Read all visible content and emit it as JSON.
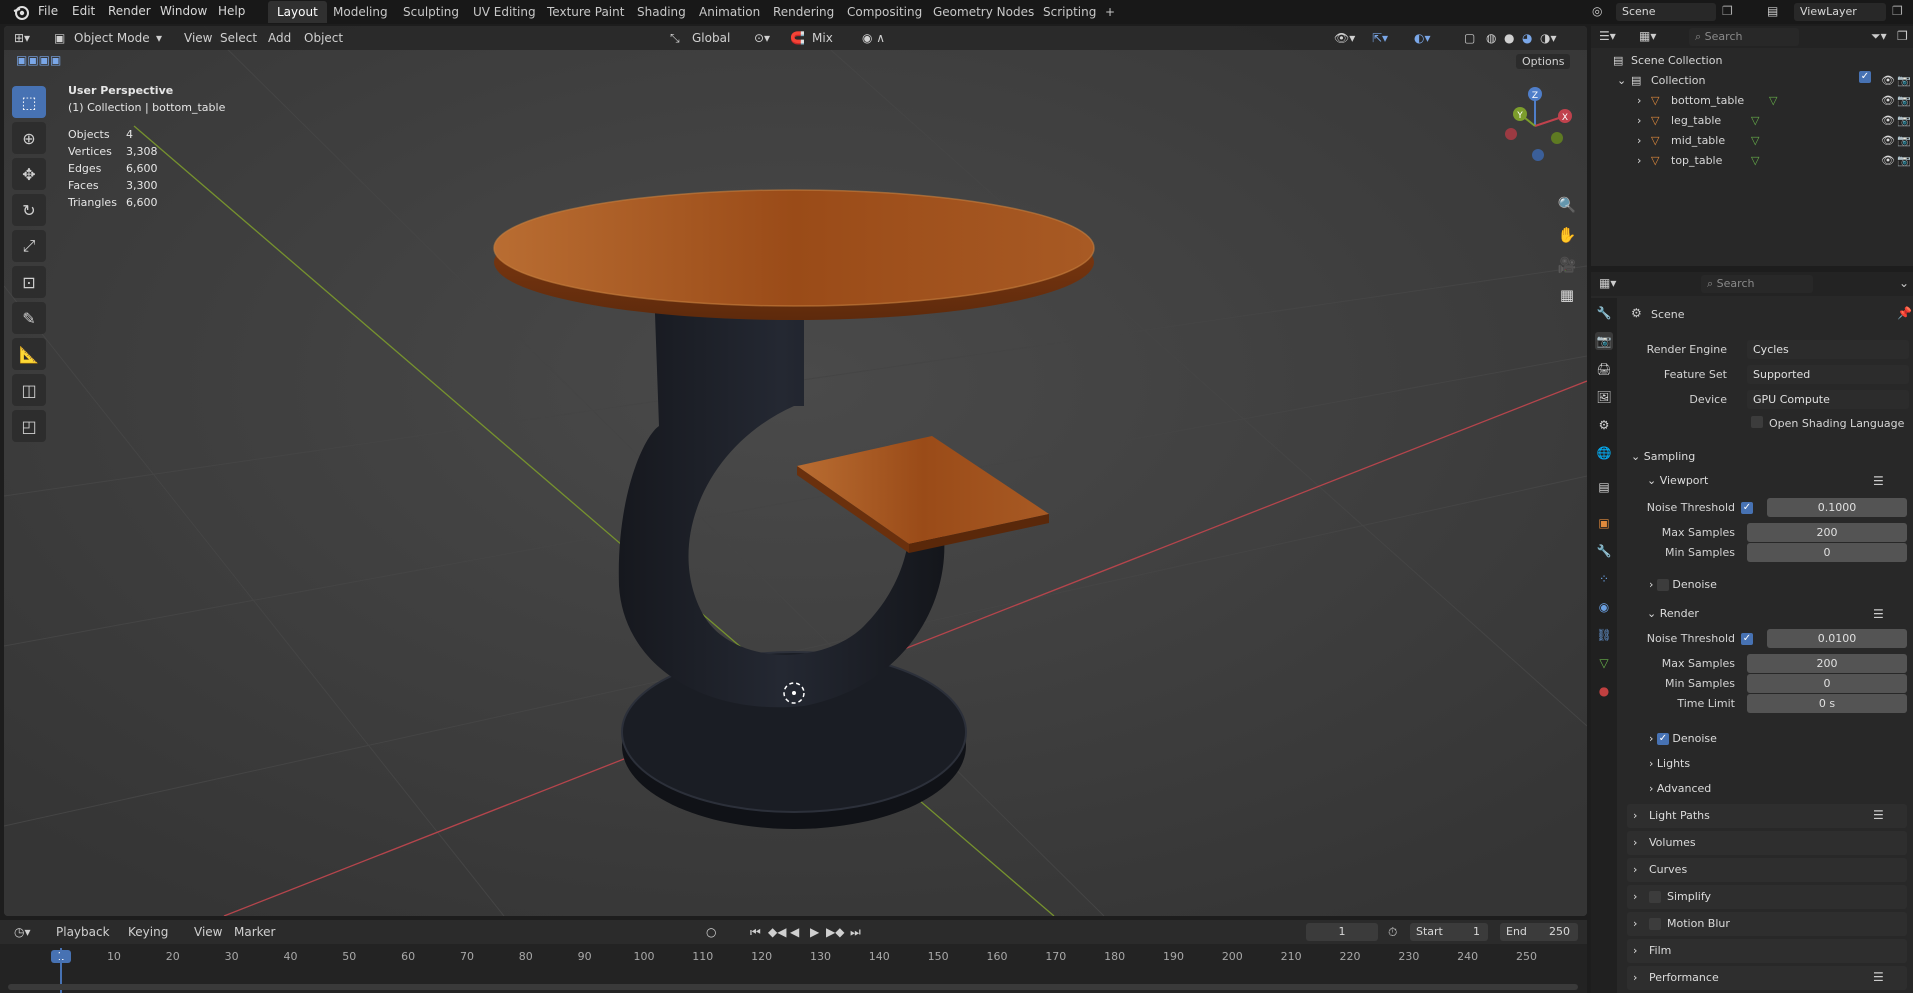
{
  "menu": [
    "File",
    "Edit",
    "Render",
    "Window",
    "Help"
  ],
  "workspaces": [
    "Layout",
    "Modeling",
    "Sculpting",
    "UV Editing",
    "Texture Paint",
    "Shading",
    "Animation",
    "Rendering",
    "Compositing",
    "Geometry Nodes",
    "Scripting"
  ],
  "add_workspace": "+",
  "scene_name": "Scene",
  "view_layer": "ViewLayer",
  "viewport": {
    "mode": "Object Mode",
    "menus": [
      "View",
      "Select",
      "Add",
      "Object"
    ],
    "transform_orientation": "Global",
    "snap_mode": "Mix",
    "options_label": "Options",
    "perspective": "User Perspective",
    "active_info": "(1) Collection | bottom_table",
    "stats": [
      {
        "label": "Objects",
        "value": "4"
      },
      {
        "label": "Vertices",
        "value": "3,308"
      },
      {
        "label": "Edges",
        "value": "6,600"
      },
      {
        "label": "Faces",
        "value": "3,300"
      },
      {
        "label": "Triangles",
        "value": "6,600"
      }
    ],
    "gizmo_axes": {
      "x": "X",
      "y": "Y",
      "z": "Z"
    }
  },
  "outliner": {
    "search_placeholder": "Search",
    "scene_collection": "Scene Collection",
    "collection": "Collection",
    "objects": [
      "bottom_table",
      "leg_table",
      "mid_table",
      "top_table"
    ]
  },
  "properties": {
    "search_placeholder": "Search",
    "context": "Scene",
    "render_engine_label": "Render Engine",
    "render_engine": "Cycles",
    "feature_set_label": "Feature Set",
    "feature_set": "Supported",
    "device_label": "Device",
    "device": "GPU Compute",
    "osl_label": "Open Shading Language",
    "sampling": "Sampling",
    "viewport_section": "Viewport",
    "vp_noise_threshold_label": "Noise Threshold",
    "vp_noise_threshold": "0.1000",
    "vp_max_samples_label": "Max Samples",
    "vp_max_samples": "200",
    "vp_min_samples_label": "Min Samples",
    "vp_min_samples": "0",
    "vp_denoise": "Denoise",
    "render_section": "Render",
    "r_noise_threshold_label": "Noise Threshold",
    "r_noise_threshold": "0.0100",
    "r_max_samples_label": "Max Samples",
    "r_max_samples": "200",
    "r_min_samples_label": "Min Samples",
    "r_min_samples": "0",
    "r_time_limit_label": "Time Limit",
    "r_time_limit": "0 s",
    "r_denoise": "Denoise",
    "lights": "Lights",
    "advanced": "Advanced",
    "panels": [
      "Light Paths",
      "Volumes",
      "Curves",
      "Simplify",
      "Motion Blur",
      "Film",
      "Performance"
    ]
  },
  "timeline": {
    "menus": [
      "Playback",
      "Keying",
      "View",
      "Marker"
    ],
    "current_frame": "1",
    "start_label": "Start",
    "start": "1",
    "end_label": "End",
    "end": "250",
    "ticks": [
      "1",
      "10",
      "20",
      "30",
      "40",
      "50",
      "60",
      "70",
      "80",
      "90",
      "100",
      "110",
      "120",
      "130",
      "140",
      "150",
      "160",
      "170",
      "180",
      "190",
      "200",
      "210",
      "220",
      "230",
      "240",
      "250"
    ]
  },
  "colors": {
    "accent": "#4772b3",
    "wood": "#9c4a18",
    "leg": "#1d2028",
    "x_axis": "#b8404a",
    "y_axis": "#7a9c2a"
  }
}
